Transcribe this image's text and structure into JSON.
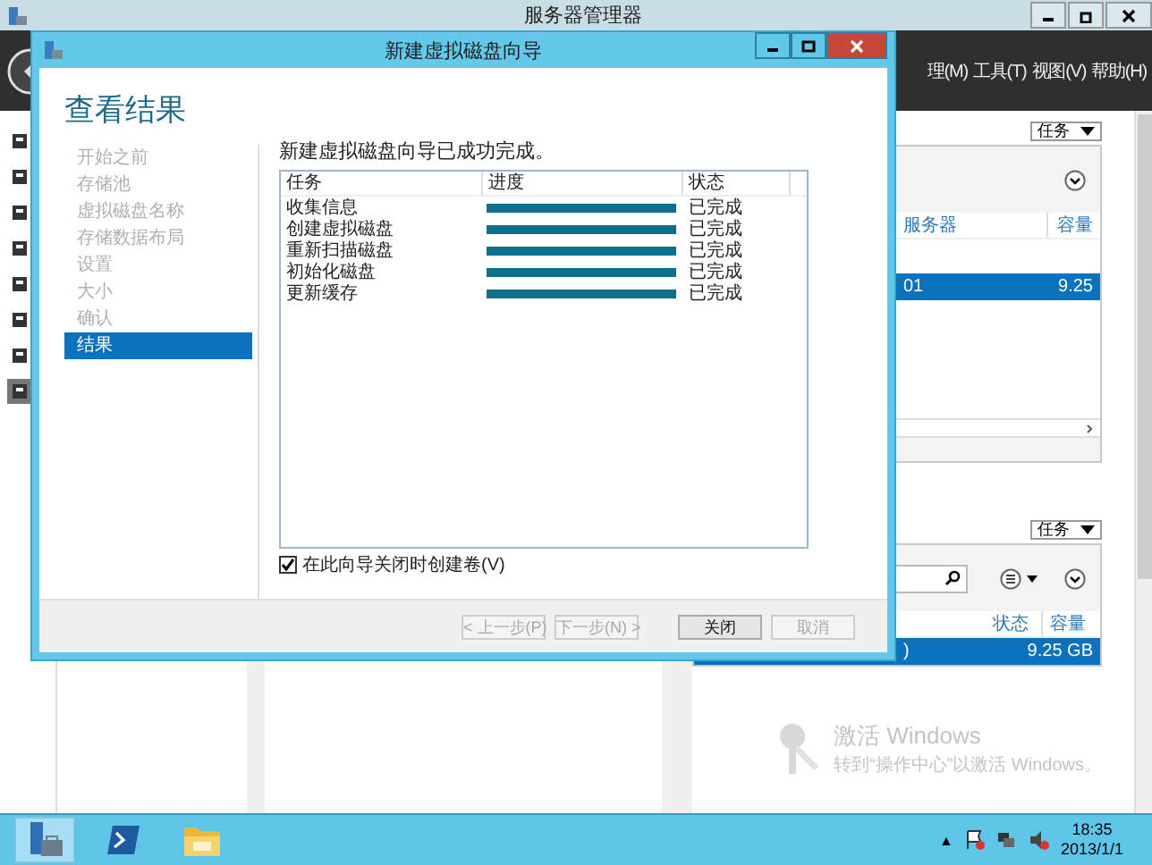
{
  "server_manager": {
    "title": "服务器管理器",
    "menu": [
      "理(M)",
      "工具(T)",
      "视图(V)",
      "帮助(H)"
    ],
    "panels": [
      {
        "tasks_label": "任务",
        "columns": [
          "服务器",
          "容量"
        ],
        "rows": [
          {
            "cells": [
              "01",
              "9.25"
            ],
            "selected": true
          }
        ]
      },
      {
        "tasks_label": "任务",
        "columns": [
          "状态",
          "容量"
        ],
        "rows": [
          {
            "cells": [
              ")",
              "9.25 GB"
            ],
            "selected": true
          }
        ]
      }
    ]
  },
  "wizard": {
    "title": "新建虚拟磁盘向导",
    "heading": "查看结果",
    "steps": [
      {
        "label": "开始之前",
        "selected": false
      },
      {
        "label": "存储池",
        "selected": false
      },
      {
        "label": "虚拟磁盘名称",
        "selected": false
      },
      {
        "label": "存储数据布局",
        "selected": false
      },
      {
        "label": "设置",
        "selected": false
      },
      {
        "label": "大小",
        "selected": false
      },
      {
        "label": "确认",
        "selected": false
      },
      {
        "label": "结果",
        "selected": true
      }
    ],
    "message": "新建虚拟磁盘向导已成功完成。",
    "table": {
      "columns": [
        "任务",
        "进度",
        "状态"
      ],
      "rows": [
        {
          "task": "收集信息",
          "level": 1,
          "status": "已完成"
        },
        {
          "task": "创建虚拟磁盘",
          "level": 1,
          "status": "已完成"
        },
        {
          "task": "重新扫描磁盘",
          "level": 1,
          "status": "已完成"
        },
        {
          "task": "初始化磁盘",
          "level": 1,
          "status": "已完成"
        },
        {
          "task": "更新缓存",
          "level": 1,
          "status": "已完成"
        }
      ]
    },
    "create_volume": {
      "label": "在此向导关闭时创建卷(V)",
      "checked": true
    },
    "buttons": [
      {
        "label": "< 上一步(P)",
        "disabled": true
      },
      {
        "label": "下一步(N) >",
        "disabled": true
      },
      {
        "label": "关闭",
        "disabled": false
      },
      {
        "label": "取消",
        "disabled": true
      }
    ]
  },
  "activation": {
    "title": "激活 Windows",
    "text": "转到“操作中心”以激活 Windows。"
  },
  "taskbar": {
    "tray_overflow": "▲",
    "clock": {
      "time": "18:35",
      "date": "2013/1/1"
    }
  }
}
